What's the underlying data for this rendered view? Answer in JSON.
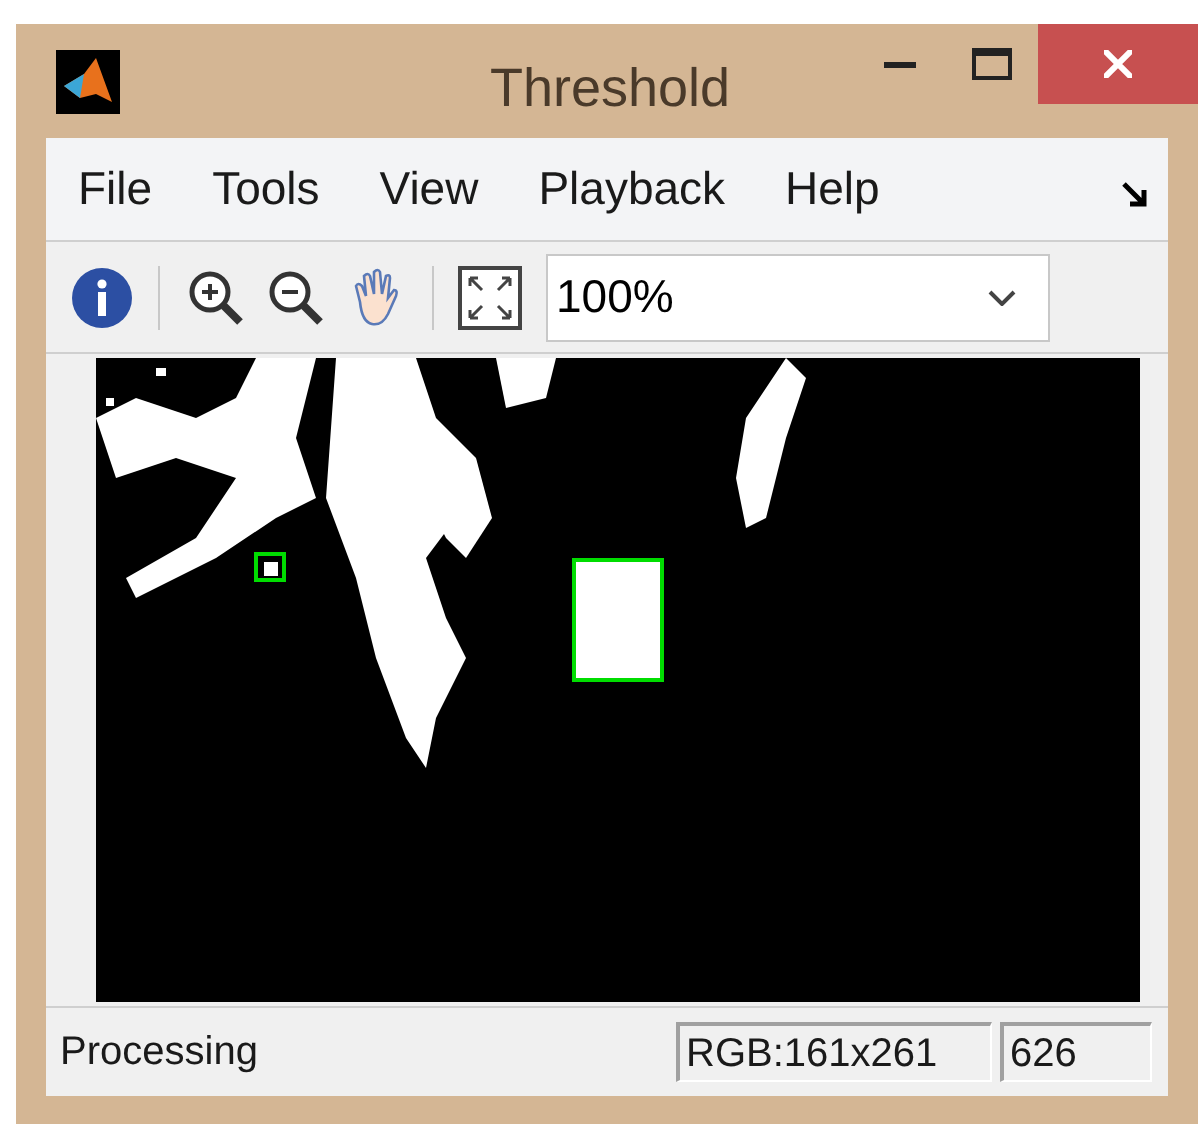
{
  "window": {
    "title": "Threshold"
  },
  "menu": [
    "File",
    "Tools",
    "View",
    "Playback",
    "Help"
  ],
  "toolbar": {
    "zoom": "100%"
  },
  "status_bar": {
    "message": "Processing",
    "fields": [
      "RGB:161x261",
      "626"
    ]
  }
}
